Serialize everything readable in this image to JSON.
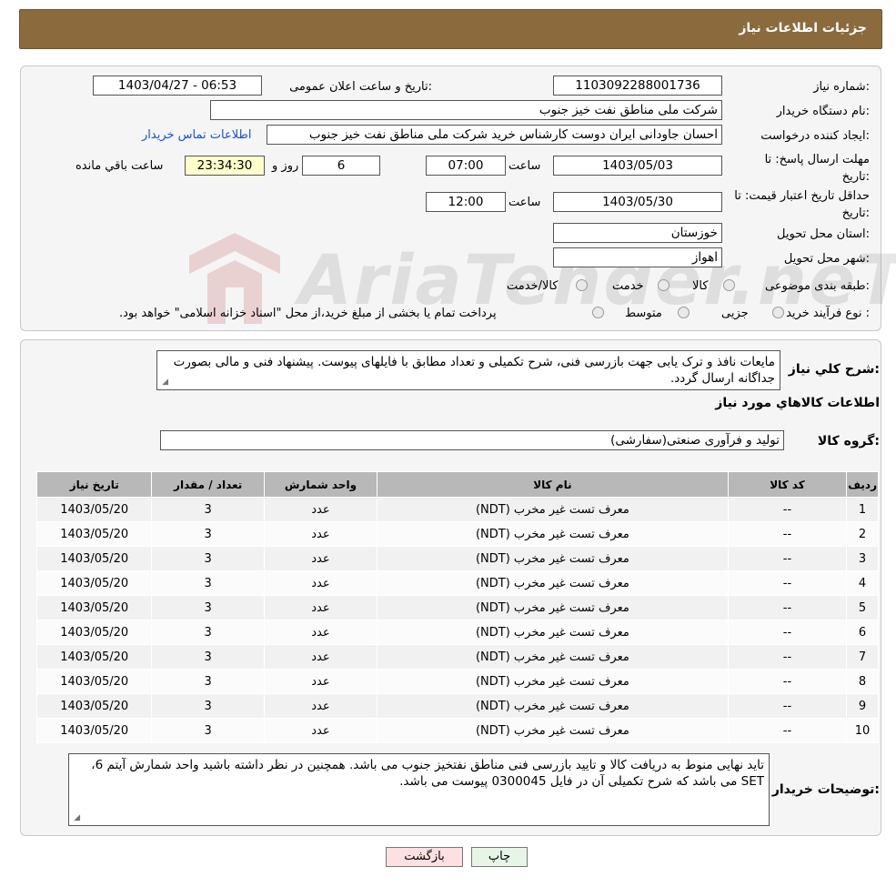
{
  "header": {
    "title": "جزئیات اطلاعات نیاز"
  },
  "form": {
    "need_number_label": "شماره نیاز:",
    "need_number": "1103092288001736",
    "announce_label": "تاریخ و ساعت اعلان عمومی:",
    "announce_value": "1403/04/27 - 06:53",
    "buyer_org_label": "نام دستگاه خریدار:",
    "buyer_org": "شرکت ملی مناطق نفت خیز جنوب",
    "creator_label": "ایجاد کننده درخواست:",
    "creator": "احسان جاودانی ایران دوست کارشناس خرید شرکت ملی مناطق نفت خیز جنوب",
    "contact_link": "اطلاعات تماس خریدار",
    "reply_deadline_label": "مهلت ارسال پاسخ: تا تاریخ:",
    "reply_date": "1403/05/03",
    "time_label": "ساعت",
    "reply_time": "07:00",
    "days_value": "6",
    "days_label": "روز و",
    "remaining_time": "23:34:30",
    "remaining_label": "ساعت باقي مانده",
    "price_validity_label": "حداقل تاریخ اعتبار قیمت: تا تاریخ:",
    "price_date": "1403/05/30",
    "price_time": "12:00",
    "province_label": "استان محل تحویل:",
    "province": "خوزستان",
    "city_label": "شهر محل تحویل:",
    "city": "اهواز",
    "category_label": "طبقه بندی موضوعی:",
    "category_options": [
      "کالا",
      "خدمت",
      "کالا/خدمت"
    ],
    "purchase_type_label": "نوع فرآیند خرید :",
    "purchase_options": [
      "جزیی",
      "متوسط"
    ],
    "purchase_note": "پرداخت تمام یا بخشی از مبلغ خرید،از محل \"اسناد خزانه اسلامی\" خواهد بود."
  },
  "watermark": {
    "text": "AriaTender.neT"
  },
  "summary": {
    "label": "شرح کلي نياز:",
    "text": "مایعات نافذ و ترک یابی جهت بازرسی فنی، شرح تکمیلی و تعداد مطابق با فایلهای پیوست. پیشنهاد فنی و مالی بصورت جداگانه ارسال گردد.",
    "items_title": "اطلاعات کالاهاي مورد نياز",
    "group_label": "گروه کالا:",
    "group_value": "تولید و فرآوری صنعتی(سفارشی)"
  },
  "table": {
    "headers": [
      "رديف",
      "کد کالا",
      "نام کالا",
      "واحد شمارش",
      "تعداد / مقدار",
      "تاریخ نیاز"
    ],
    "rows": [
      [
        "1",
        "--",
        "معرف تست غیر مخرب (NDT)",
        "عدد",
        "3",
        "1403/05/20"
      ],
      [
        "2",
        "--",
        "معرف تست غیر مخرب (NDT)",
        "عدد",
        "3",
        "1403/05/20"
      ],
      [
        "3",
        "--",
        "معرف تست غیر مخرب (NDT)",
        "عدد",
        "3",
        "1403/05/20"
      ],
      [
        "4",
        "--",
        "معرف تست غیر مخرب (NDT)",
        "عدد",
        "3",
        "1403/05/20"
      ],
      [
        "5",
        "--",
        "معرف تست غیر مخرب (NDT)",
        "عدد",
        "3",
        "1403/05/20"
      ],
      [
        "6",
        "--",
        "معرف تست غیر مخرب (NDT)",
        "عدد",
        "3",
        "1403/05/20"
      ],
      [
        "7",
        "--",
        "معرف تست غیر مخرب (NDT)",
        "عدد",
        "3",
        "1403/05/20"
      ],
      [
        "8",
        "--",
        "معرف تست غیر مخرب (NDT)",
        "عدد",
        "3",
        "1403/05/20"
      ],
      [
        "9",
        "--",
        "معرف تست غیر مخرب (NDT)",
        "عدد",
        "3",
        "1403/05/20"
      ],
      [
        "10",
        "--",
        "معرف تست غیر مخرب (NDT)",
        "عدد",
        "3",
        "1403/05/20"
      ]
    ]
  },
  "buyer_notes": {
    "label": "توضیحات خریدار:",
    "text": "تاید نهایی منوط به دریافت کالا و تایید بازرسی فنی مناطق نفتخیز جنوب می باشد. همچنین در نظر داشته باشید واحد شمارش آیتم 6، SET می باشد که شرح تکمیلی آن در فایل 0300045 پیوست می باشد."
  },
  "buttons": {
    "print": "چاپ",
    "back": "بازگشت"
  },
  "colors": {
    "header_bg": "#8b6b3d",
    "print_bg": "#e6f5e6",
    "back_bg": "#ffe0e0",
    "link": "#1a4ee0"
  }
}
